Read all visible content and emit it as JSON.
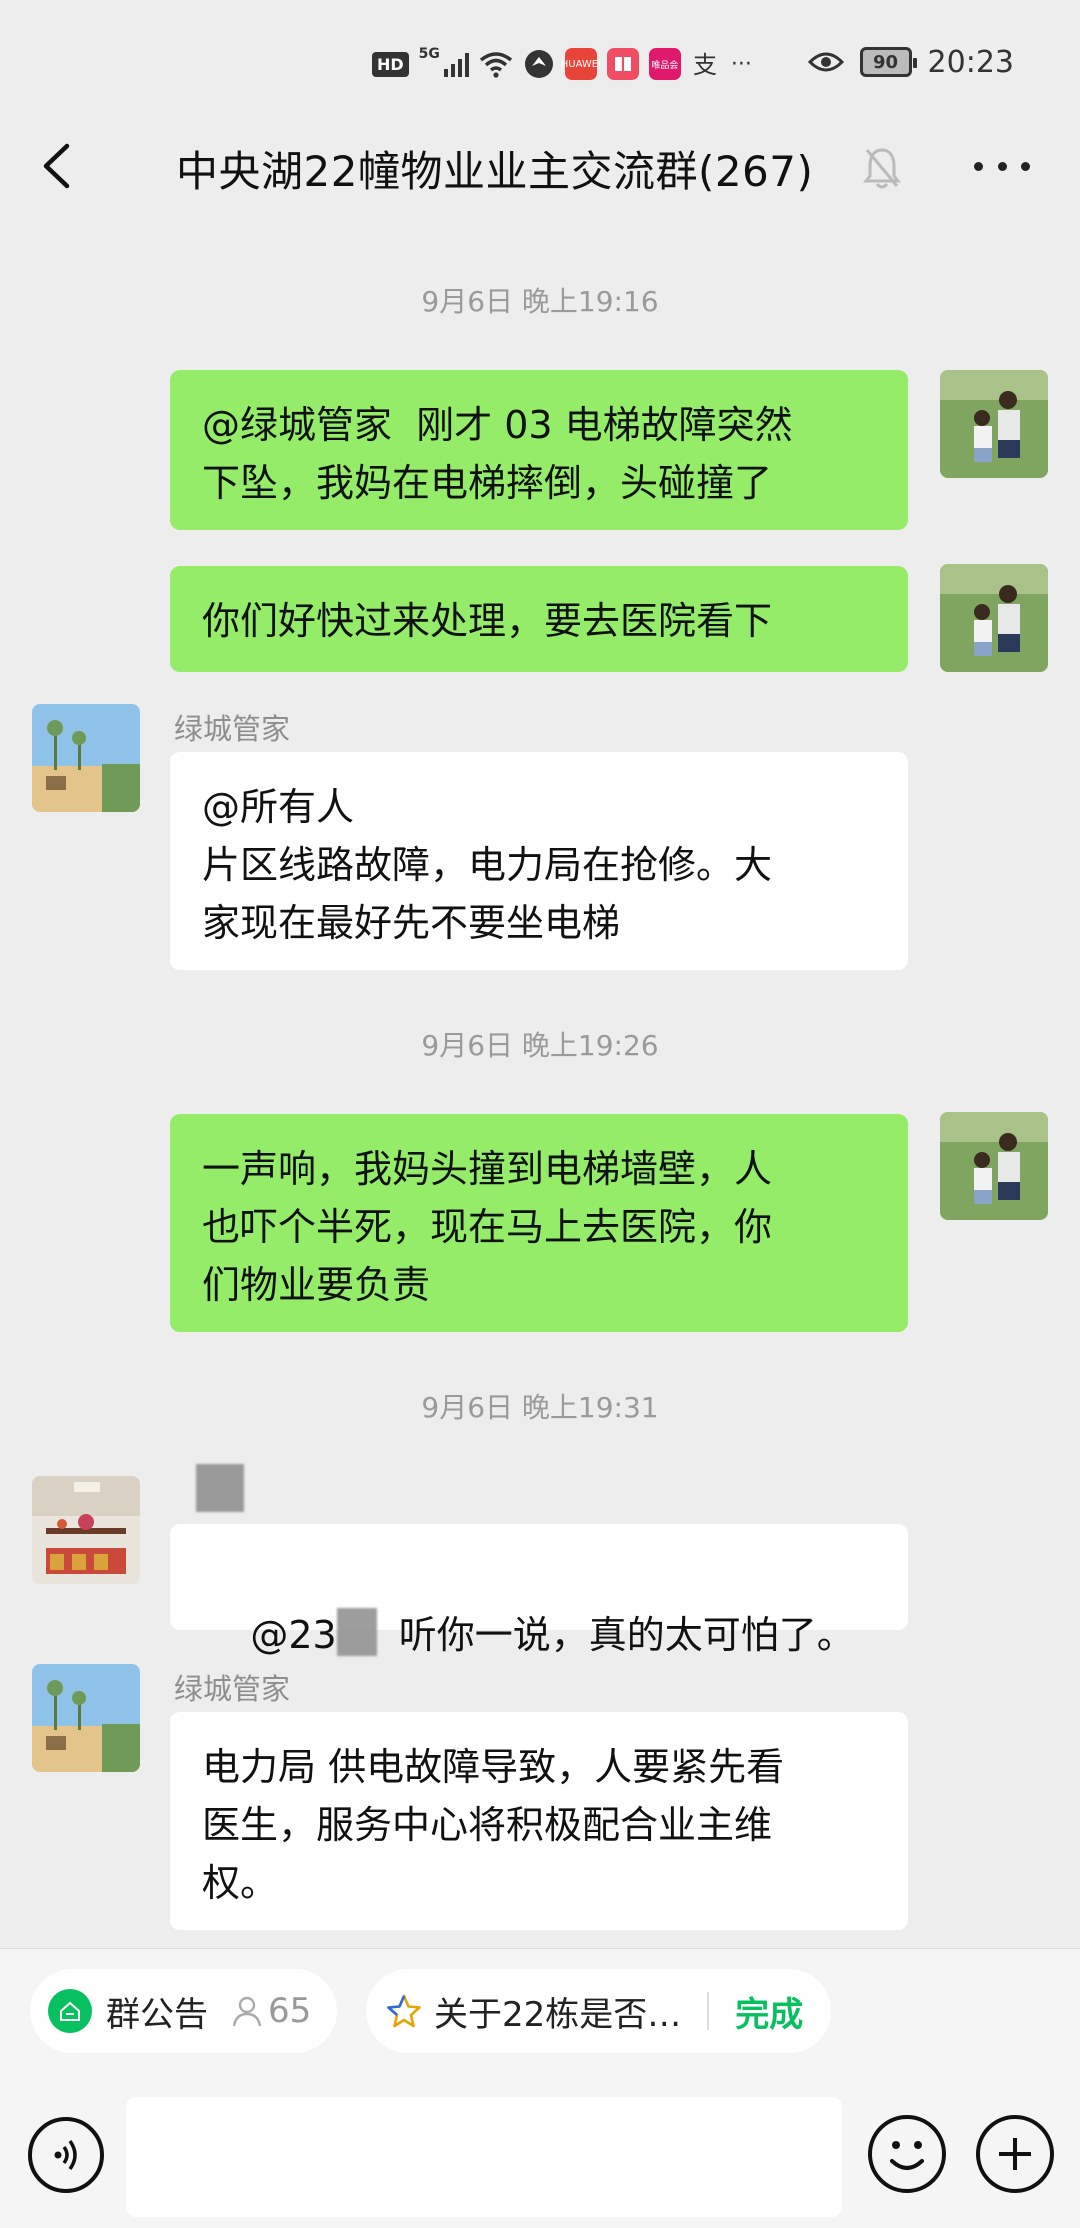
{
  "status_bar": {
    "hd": "HD",
    "network": "5G",
    "battery": "90",
    "time": "20:23",
    "icons": [
      "hd-icon",
      "signal-icon",
      "wifi-icon",
      "vpn-icon",
      "huawei-app-icon",
      "book-app-icon",
      "store-app-icon",
      "alipay-icon",
      "eye-icon",
      "battery-icon"
    ],
    "more": "···"
  },
  "header": {
    "title": "中央湖22幢物业业主交流群(267)",
    "muted_icon": "bell-muted-icon",
    "back_icon": "chevron-left-icon",
    "more_icon": "more-dots-icon"
  },
  "messages": {
    "ts1": "9月6日 晚上19:16",
    "m1": "@绿城管家  刚才 03 电梯故障突然\n下坠，我妈在电梯摔倒，头碰撞了",
    "m2": "你们好快过来处理，要去医院看下",
    "m3_sender": "绿城管家",
    "m3": "@所有人\n片区线路故障，电力局在抢修。大\n家现在最好先不要坐电梯",
    "ts2": "9月6日 晚上19:26",
    "m4": "一声响，我妈头撞到电梯墙壁，人\n也吓个半死，现在马上去医院，你\n们物业要负责",
    "ts3": "9月6日 晚上19:31",
    "m5_prefix": "@23",
    "m5_suffix": "听你一说，真的太可怕了。",
    "m6_sender": "绿城管家",
    "m6": "电力局 供电故障导致，人要紧先看\n医生，服务中心将积极配合业主维\n权。"
  },
  "bottom": {
    "notice_label": "群公告",
    "read_count": "65",
    "topic_label": "关于22栋是否…",
    "done_label": "完成",
    "input_placeholder": ""
  },
  "colors": {
    "my_bubble": "#95ec69",
    "other_bubble": "#ffffff",
    "background": "#ededed",
    "accent_green": "#07c160"
  }
}
